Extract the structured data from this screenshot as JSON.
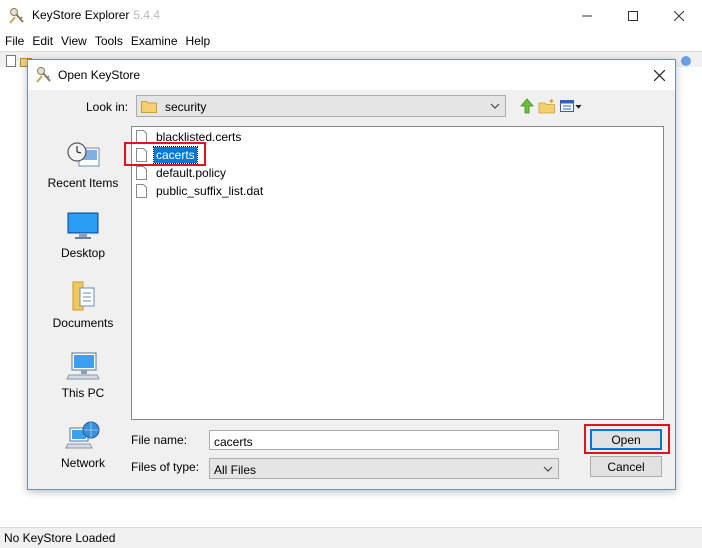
{
  "app": {
    "title": "KeyStore Explorer",
    "version": "5.4.4",
    "menu": [
      "File",
      "Edit",
      "View",
      "Tools",
      "Examine",
      "Help"
    ]
  },
  "window_controls": [
    "minimize-icon",
    "maximize-icon",
    "close-icon"
  ],
  "dialog": {
    "title": "Open KeyStore",
    "look_in_label": "Look in:",
    "look_in_value": "security",
    "places": [
      {
        "label": "Recent Items",
        "icon": "recent-items-icon"
      },
      {
        "label": "Desktop",
        "icon": "desktop-icon"
      },
      {
        "label": "Documents",
        "icon": "documents-icon"
      },
      {
        "label": "This PC",
        "icon": "this-pc-icon"
      },
      {
        "label": "Network",
        "icon": "network-icon"
      }
    ],
    "files": [
      {
        "name": "blacklisted.certs",
        "selected": false
      },
      {
        "name": "cacerts",
        "selected": true
      },
      {
        "name": "default.policy",
        "selected": false
      },
      {
        "name": "public_suffix_list.dat",
        "selected": false
      }
    ],
    "file_name_label": "File name:",
    "file_name_value": "cacerts",
    "files_of_type_label": "Files of type:",
    "files_of_type_value": "All Files",
    "open_label": "Open",
    "cancel_label": "Cancel"
  },
  "status": "No KeyStore Loaded",
  "colors": {
    "selection": "#0078d7",
    "highlight": "#e0141e",
    "dialog_bg": "#f0f0f0"
  }
}
